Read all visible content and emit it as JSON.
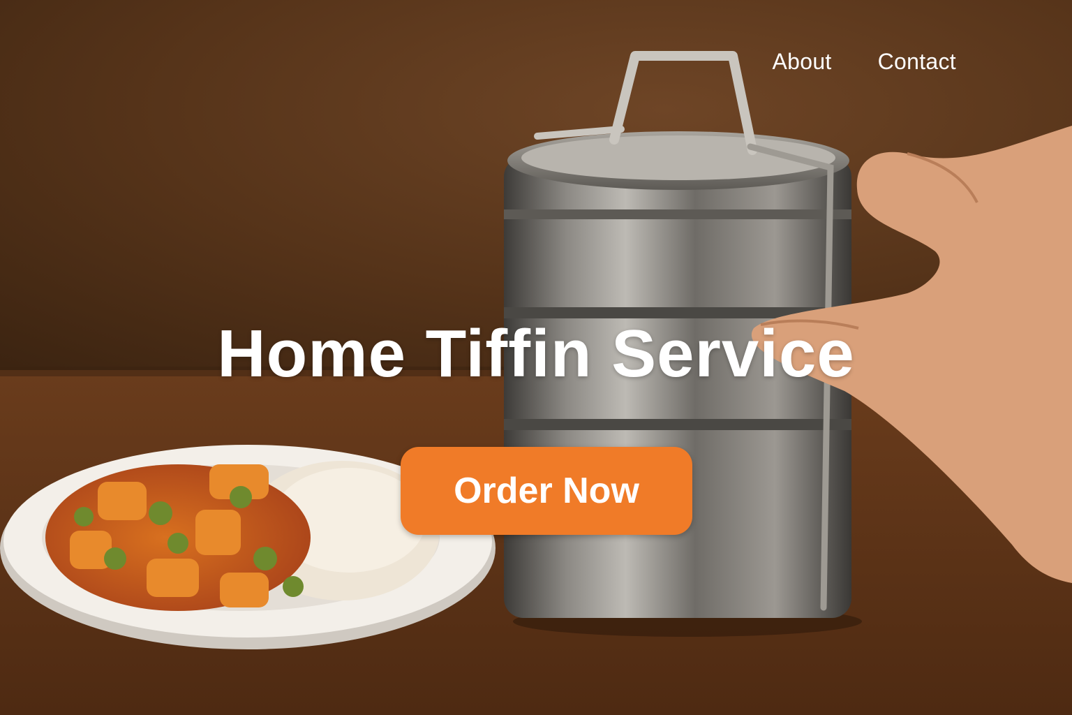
{
  "nav": {
    "about_label": "About",
    "contact_label": "Contact"
  },
  "hero": {
    "title": "Home Tiffin Service",
    "cta_label": "Order Now"
  },
  "colors": {
    "accent": "#F07B28",
    "text": "#FFFFFF",
    "background": "#5A3820",
    "table": "#6B3D1E"
  }
}
